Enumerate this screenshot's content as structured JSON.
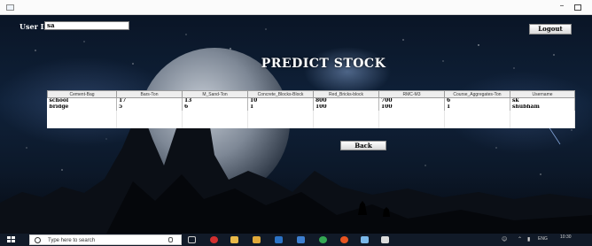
{
  "header": {
    "user_id_label": "User ID",
    "user_id_value": "sa",
    "logout_label": "Logout"
  },
  "title": "PREDICT STOCK",
  "table": {
    "columns": [
      "Cement-Bag",
      "Bars-Ton",
      "M_Sand-Ton",
      "Concrete_Blocks-Block",
      "Red_Bricks-block",
      "RMC-M3",
      "Course_Aggregates-Ton",
      "Username"
    ],
    "rows": [
      [
        "school",
        "17",
        "13",
        "10",
        "800",
        "700",
        "6",
        "sk"
      ],
      [
        "bridge",
        "5",
        "6",
        "1",
        "100",
        "100",
        "1",
        "shubham"
      ]
    ]
  },
  "back_label": "Back",
  "taskbar": {
    "search_placeholder": "Type here to search",
    "language": "ENG",
    "time": "10:30",
    "icons": [
      "task-view-icon",
      "opera-icon",
      "file-explorer-icon",
      "edge-icon",
      "store-icon",
      "chrome-icon",
      "settings-icon",
      "java-icon"
    ],
    "colors": {
      "taskbar": "#111a28",
      "accent": "#2b73c6"
    }
  }
}
